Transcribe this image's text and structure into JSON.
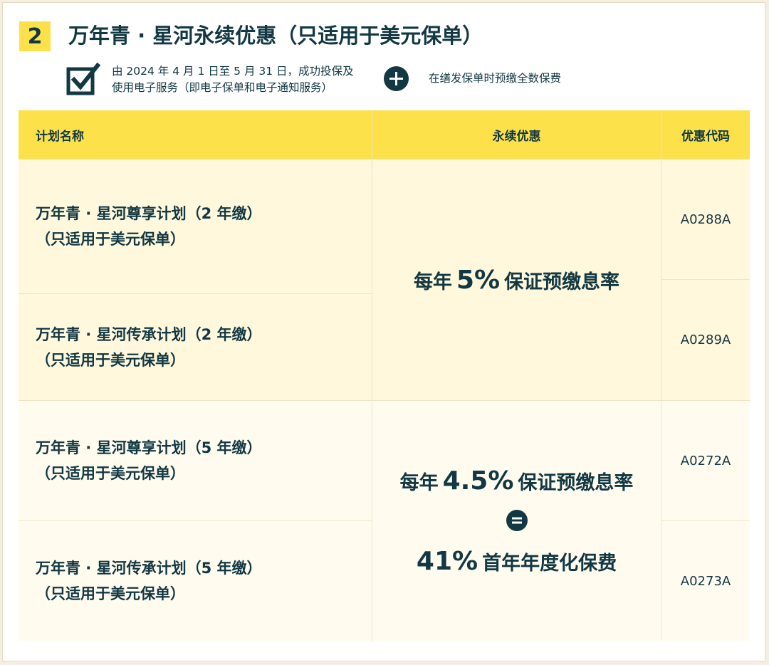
{
  "section": {
    "number": "2",
    "title": "万年青 · 星河永续优惠（只适用于美元保单）"
  },
  "conditions": {
    "line1": "由 2024 年 4 月 1 日至 5 月 31 日，成功投保及",
    "line2": "使用电子服务（即电子保单和电子通知服务）",
    "plus_text": "在缮发保单时预缴全数保费"
  },
  "table": {
    "headers": {
      "plan": "计划名称",
      "offer": "永续优惠",
      "code": "优惠代码"
    },
    "rows": [
      {
        "plan_line1": "万年青 · 星河尊享计划（2 年缴）",
        "plan_line2": "（只适用于美元保单）",
        "code": "A0288A"
      },
      {
        "plan_line1": "万年青 · 星河传承计划（2 年缴）",
        "plan_line2": "（只适用于美元保单）",
        "code": "A0289A"
      },
      {
        "plan_line1": "万年青 · 星河尊享计划（5 年缴）",
        "plan_line2": "（只适用于美元保单）",
        "code": "A0272A"
      },
      {
        "plan_line1": "万年青 · 星河传承计划（5 年缴）",
        "plan_line2": "（只适用于美元保单）",
        "code": "A0273A"
      }
    ],
    "offer_group1": {
      "prefix": "每年",
      "rate": "5%",
      "suffix": "保证预缴息率"
    },
    "offer_group2": {
      "prefix": "每年",
      "rate": "4.5%",
      "suffix": "保证预缴息率",
      "second_rate": "41%",
      "second_suffix": "首年年度化保费"
    }
  },
  "colors": {
    "accent_yellow": "#fde14a",
    "row_yellow": "#fff8dc",
    "row_cream": "#fffcef",
    "text_dark": "#123843"
  }
}
